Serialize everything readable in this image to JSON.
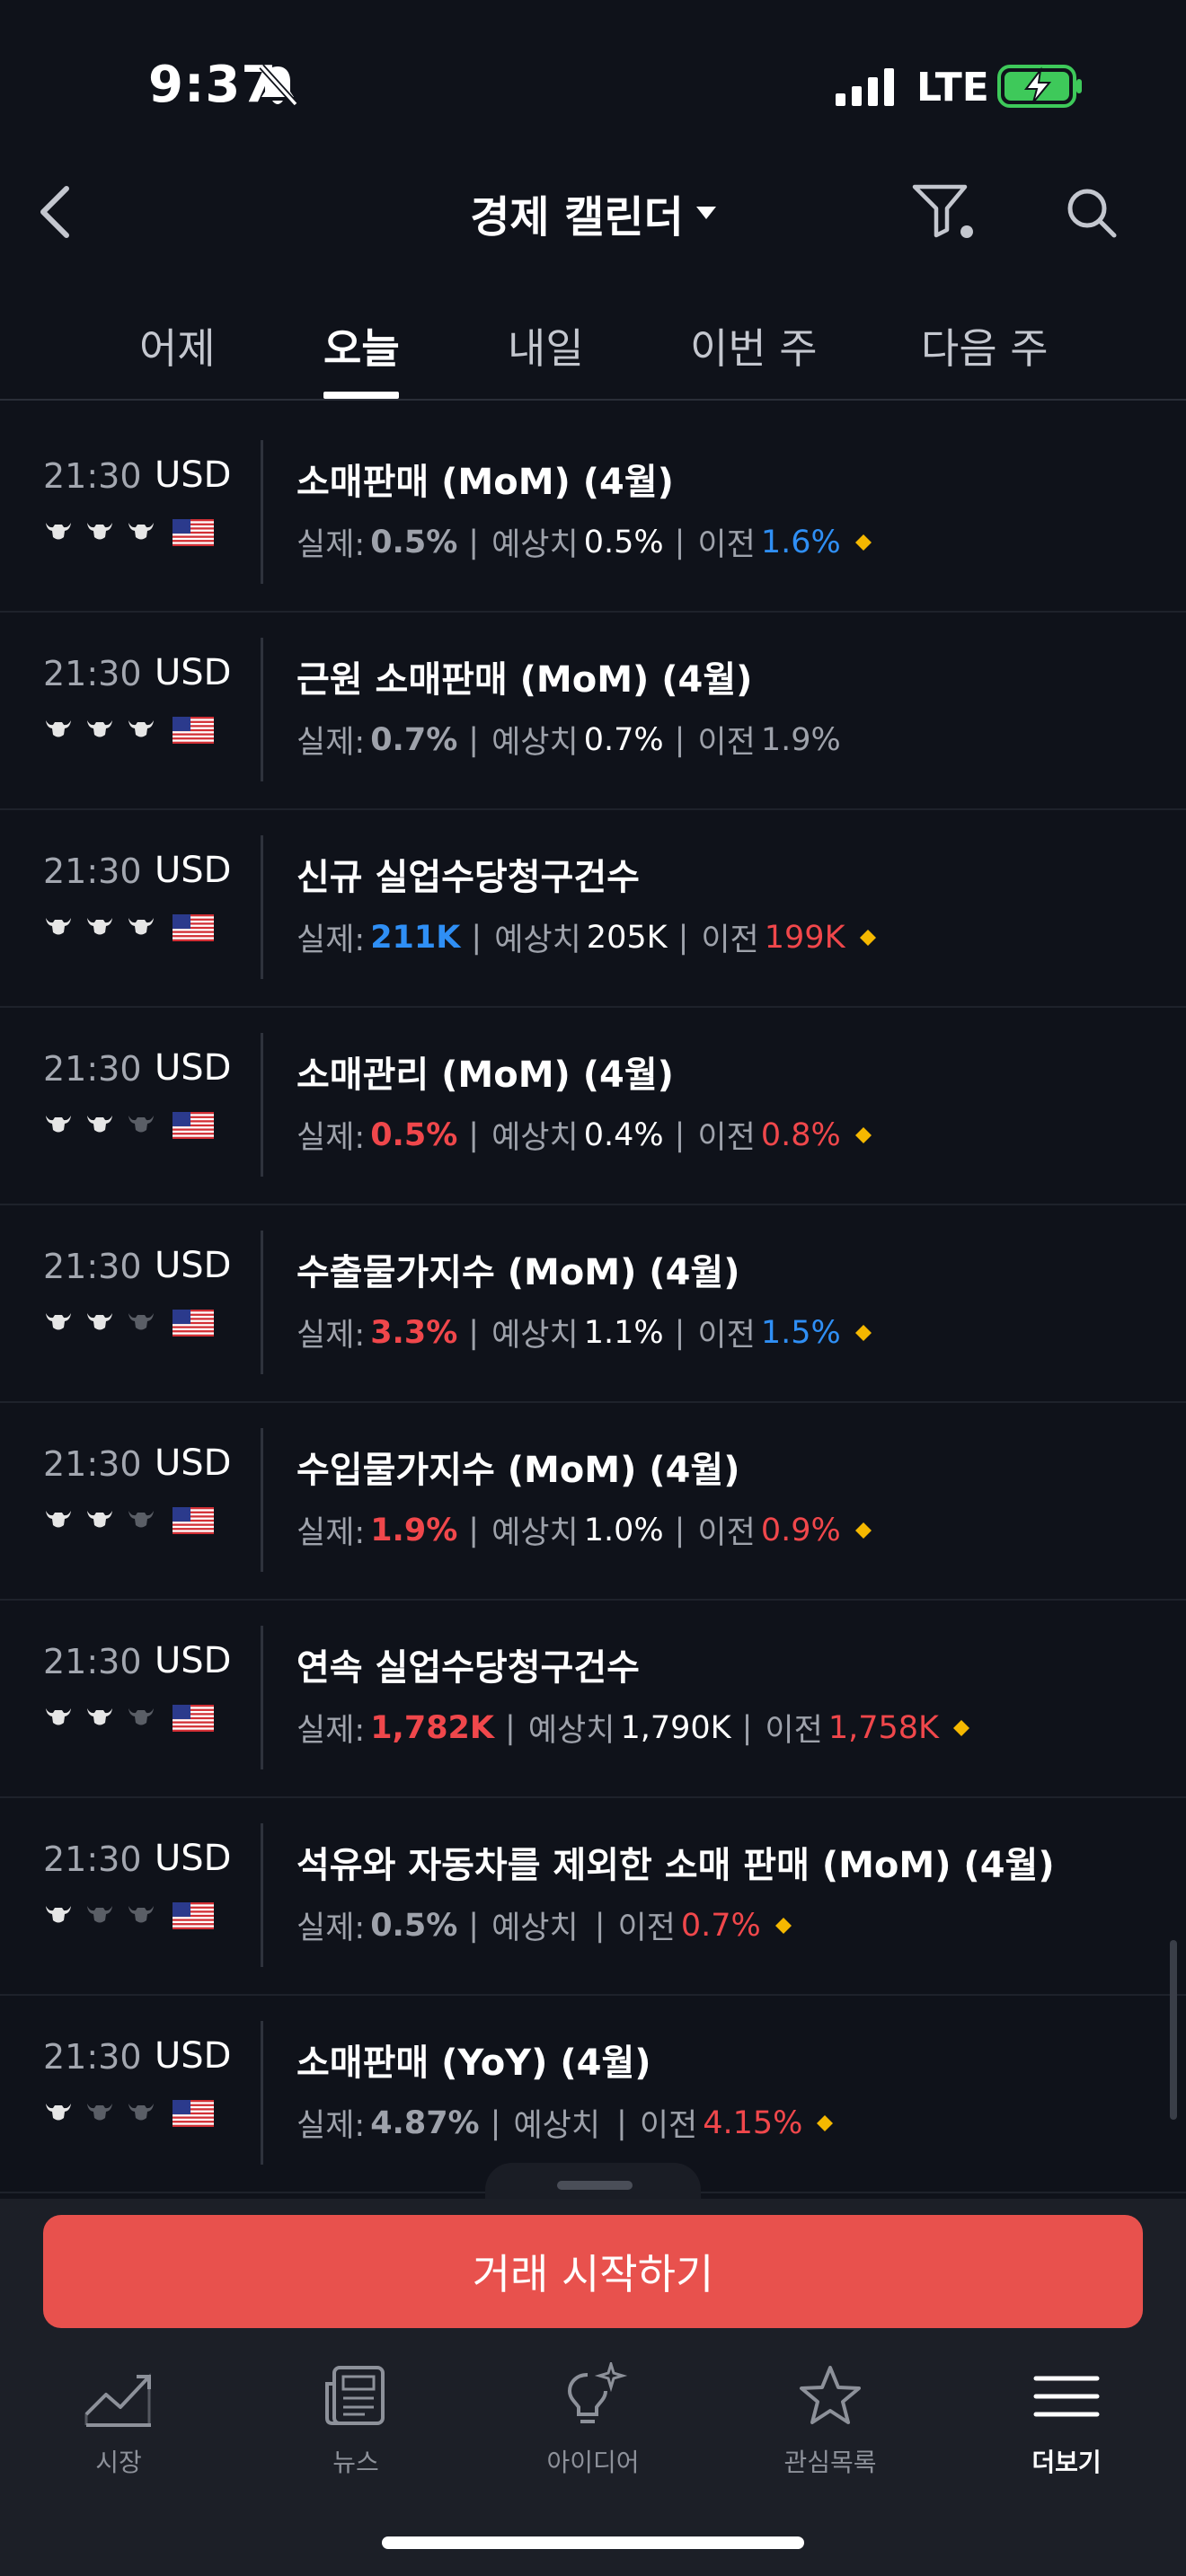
{
  "status_bar": {
    "time": "9:37",
    "network": "LTE"
  },
  "header": {
    "title": "경제 캘린더"
  },
  "tabs": [
    {
      "label": "어제"
    },
    {
      "label": "오늘"
    },
    {
      "label": "내일"
    },
    {
      "label": "이번 주"
    },
    {
      "label": "다음 주"
    }
  ],
  "labels": {
    "actual": "실제:",
    "forecast": "예상치",
    "previous": "이전",
    "separator": "|"
  },
  "colors": {
    "up": "#2f8ff5",
    "down": "#f0474b",
    "cta": "#e8514d",
    "diamond": "#f5b800"
  },
  "events": [
    {
      "time": "21:30",
      "currency": "USD",
      "importance": 3,
      "title": "소매판매 (MoM) (4월)",
      "actual": "0.5%",
      "actual_color": "gray",
      "forecast": "0.5%",
      "previous": "1.6%",
      "previous_color": "blue",
      "revised": true
    },
    {
      "time": "21:30",
      "currency": "USD",
      "importance": 3,
      "title": "근원 소매판매 (MoM) (4월)",
      "actual": "0.7%",
      "actual_color": "gray",
      "forecast": "0.7%",
      "previous": "1.9%",
      "previous_color": "gray",
      "revised": false
    },
    {
      "time": "21:30",
      "currency": "USD",
      "importance": 3,
      "title": "신규 실업수당청구건수",
      "actual": "211K",
      "actual_color": "blue",
      "forecast": "205K",
      "previous": "199K",
      "previous_color": "red",
      "revised": true
    },
    {
      "time": "21:30",
      "currency": "USD",
      "importance": 2,
      "title": "소매관리 (MoM) (4월)",
      "actual": "0.5%",
      "actual_color": "red",
      "forecast": "0.4%",
      "previous": "0.8%",
      "previous_color": "red",
      "revised": true
    },
    {
      "time": "21:30",
      "currency": "USD",
      "importance": 2,
      "title": "수출물가지수 (MoM) (4월)",
      "actual": "3.3%",
      "actual_color": "red",
      "forecast": "1.1%",
      "previous": "1.5%",
      "previous_color": "blue",
      "revised": true
    },
    {
      "time": "21:30",
      "currency": "USD",
      "importance": 2,
      "title": "수입물가지수 (MoM) (4월)",
      "actual": "1.9%",
      "actual_color": "red",
      "forecast": "1.0%",
      "previous": "0.9%",
      "previous_color": "red",
      "revised": true
    },
    {
      "time": "21:30",
      "currency": "USD",
      "importance": 2,
      "title": "연속 실업수당청구건수",
      "actual": "1,782K",
      "actual_color": "red",
      "forecast": "1,790K",
      "previous": "1,758K",
      "previous_color": "red",
      "revised": true
    },
    {
      "time": "21:30",
      "currency": "USD",
      "importance": 1,
      "title": "석유와 자동차를 제외한 소매 판매 (MoM) (4월)",
      "actual": "0.5%",
      "actual_color": "gray",
      "forecast": "",
      "previous": "0.7%",
      "previous_color": "red",
      "revised": true
    },
    {
      "time": "21:30",
      "currency": "USD",
      "importance": 1,
      "title": "소매판매 (YoY) (4월)",
      "actual": "4.87%",
      "actual_color": "gray",
      "forecast": "",
      "previous": "4.15%",
      "previous_color": "red",
      "revised": true
    }
  ],
  "cta": {
    "label": "거래 시작하기"
  },
  "nav": [
    {
      "label": "시장",
      "icon": "chart-icon"
    },
    {
      "label": "뉴스",
      "icon": "news-icon"
    },
    {
      "label": "아이디어",
      "icon": "idea-icon"
    },
    {
      "label": "관심목록",
      "icon": "star-icon"
    },
    {
      "label": "더보기",
      "icon": "menu-icon"
    }
  ]
}
